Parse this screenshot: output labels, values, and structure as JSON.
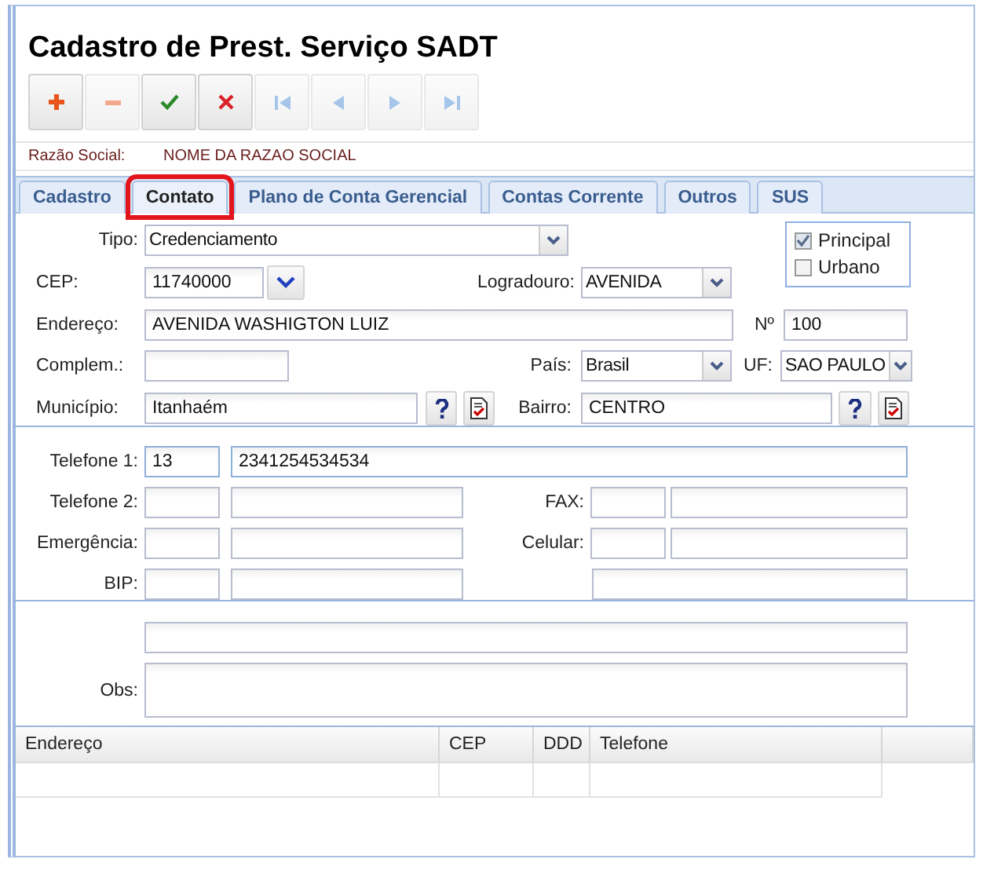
{
  "title": "Cadastro de Prest. Serviço SADT",
  "toolbar": [
    {
      "kind": "add",
      "disabled": false
    },
    {
      "kind": "remove",
      "disabled": true
    },
    {
      "kind": "confirm",
      "disabled": false
    },
    {
      "kind": "cancel",
      "disabled": false
    },
    {
      "kind": "first",
      "disabled": true
    },
    {
      "kind": "prev",
      "disabled": true
    },
    {
      "kind": "next",
      "disabled": true
    },
    {
      "kind": "last",
      "disabled": true
    }
  ],
  "razao_social": {
    "label": "Razão Social:",
    "value": "NOME DA RAZAO SOCIAL"
  },
  "tabs": [
    {
      "label": "Cadastro",
      "selected": false
    },
    {
      "label": "Contato",
      "selected": true
    },
    {
      "label": "Plano de Conta Gerencial",
      "selected": false
    },
    {
      "label": "Contas Corrente",
      "selected": false
    },
    {
      "label": "Outros",
      "selected": false
    },
    {
      "label": "SUS",
      "selected": false
    }
  ],
  "address": {
    "tipo": {
      "label": "Tipo:",
      "value": "Credenciamento"
    },
    "cep": {
      "label": "CEP:",
      "value": "11740000"
    },
    "logradouro": {
      "label": "Logradouro:",
      "value": "AVENIDA"
    },
    "endereco": {
      "label": "Endereço:",
      "value": "AVENIDA WASHIGTON LUIZ"
    },
    "numero": {
      "label": "Nº",
      "value": "100"
    },
    "complemento": {
      "label": "Complem.:"
    },
    "pais": {
      "label": "País:",
      "value": "Brasil"
    },
    "uf": {
      "label": "UF:",
      "value": "SAO PAULO"
    },
    "municipio": {
      "label": "Município:",
      "value": "Itanhaém"
    },
    "bairro": {
      "label": "Bairro:",
      "value": "CENTRO"
    },
    "flags": [
      {
        "label": "Principal",
        "checked": true
      },
      {
        "label": "Urbano",
        "checked": false
      }
    ]
  },
  "phones": [
    {
      "kind": "full",
      "label": "Telefone 1:",
      "ddd": "13",
      "number": "2341254534534",
      "focused": true
    },
    {
      "kind": "split",
      "label": "Telefone 2:",
      "focused": false,
      "right": {
        "kind": "pair",
        "label": "FAX:"
      }
    },
    {
      "kind": "split",
      "label": "Emergência:",
      "focused": false,
      "right": {
        "kind": "pair",
        "label": "Celular:"
      }
    },
    {
      "kind": "split",
      "label": "BIP:",
      "focused": false,
      "right": {
        "kind": "single"
      }
    }
  ],
  "obs": {
    "label": "Obs:"
  },
  "table": {
    "columns": [
      "Endereço",
      "CEP",
      "DDD",
      "Telefone"
    ]
  }
}
